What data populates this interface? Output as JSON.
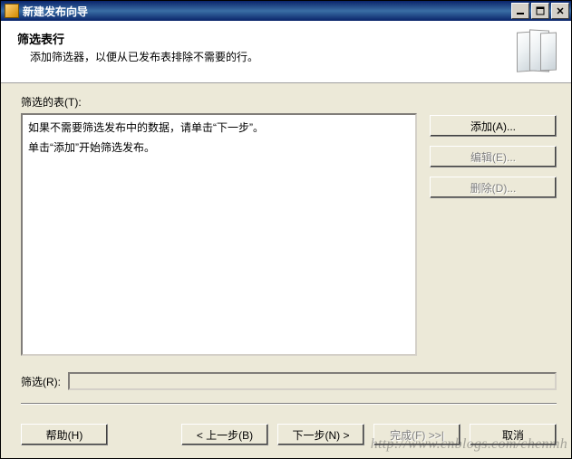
{
  "window": {
    "title": "新建发布向导"
  },
  "header": {
    "title": "筛选表行",
    "subtitle": "添加筛选器，以便从已发布表排除不需要的行。"
  },
  "main": {
    "table_label": "筛选的表(T):",
    "listbox": {
      "line1": "如果不需要筛选发布中的数据，请单击“下一步”。",
      "line2": "单击“添加”开始筛选发布。"
    },
    "buttons": {
      "add": "添加(A)...",
      "edit": "编辑(E)...",
      "delete": "删除(D)..."
    },
    "filter_label": "筛选(R):",
    "filter_value": ""
  },
  "footer": {
    "help": "帮助(H)",
    "back": "< 上一步(B)",
    "next": "下一步(N) >",
    "finish": "完成(F) >>|",
    "cancel": "取消"
  },
  "watermark": "http://www.cnblogs.com/chenmh"
}
